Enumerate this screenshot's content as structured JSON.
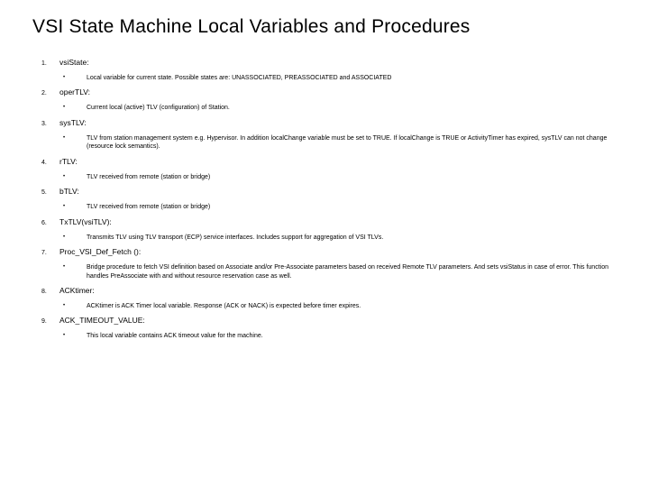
{
  "title": "VSI State Machine Local Variables and Procedures",
  "items": [
    {
      "n": "1.",
      "term": "vsiState:",
      "desc": "Local variable for current state. Possible states are: UNASSOCIATED, PREASSOCIATED and ASSOCIATED"
    },
    {
      "n": "2.",
      "term": "operTLV:",
      "desc": "Current local (active) TLV (configuration) of Station."
    },
    {
      "n": "3.",
      "term": "sysTLV:",
      "desc": "TLV from station management system e.g. Hypervisor. In addition localChange variable must be set to TRUE. If localChange is TRUE or ActivityTimer has expired, sysTLV can not change (resource lock semantics)."
    },
    {
      "n": "4.",
      "term": "rTLV:",
      "desc": "TLV received from remote (station or bridge)"
    },
    {
      "n": "5.",
      "term": "bTLV:",
      "desc": "TLV received from remote (station or bridge)"
    },
    {
      "n": "6.",
      "term": "TxTLV(vsiTLV):",
      "desc": "Transmits TLV using TLV transport (ECP) service interfaces. Includes support for aggregation of VSI TLVs."
    },
    {
      "n": "7.",
      "term": "Proc_VSI_Def_Fetch ():",
      "desc": "Bridge procedure to fetch VSI definition based on Associate and/or Pre-Associate parameters based on received Remote TLV parameters. And sets vsiStatus in case of error. This function handles PreAssociate with and without resource reservation case as well."
    },
    {
      "n": "8.",
      "term": "ACKtimer:",
      "desc": "ACKtimer is ACK Timer local variable. Response (ACK or NACK) is expected before timer expires."
    },
    {
      "n": "9.",
      "term": "ACK_TIMEOUT_VALUE:",
      "desc": "This local variable contains ACK timeout value for the machine."
    }
  ]
}
